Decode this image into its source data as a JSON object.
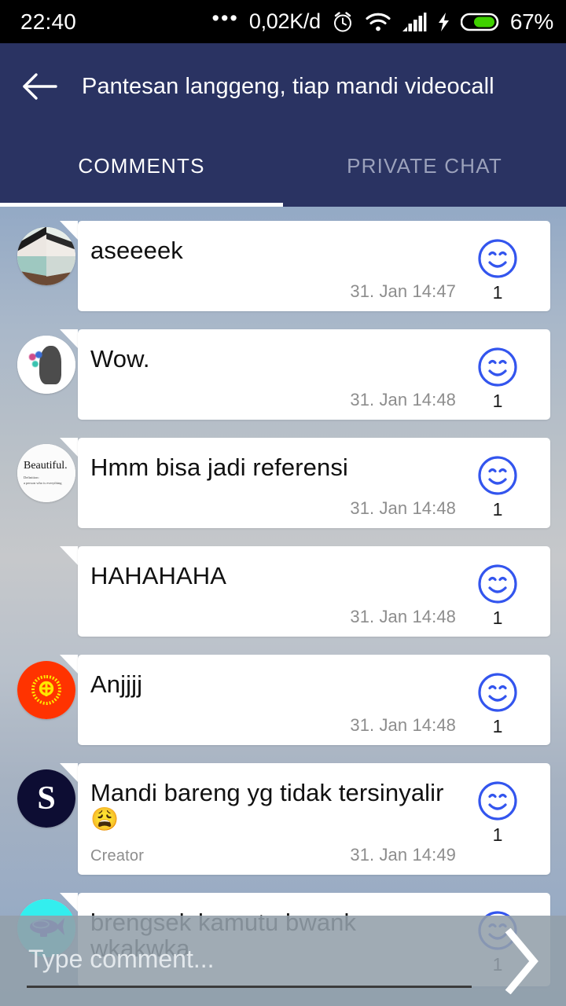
{
  "statusbar": {
    "time": "22:40",
    "dots": "•••",
    "data_rate": "0,02K/d",
    "alarm_icon": "alarm-clock-icon",
    "wifi_icon": "wifi-icon",
    "signal_icon": "signal-bars-icon",
    "charging_icon": "charging-bolt-icon",
    "battery_icon": "battery-icon",
    "battery_percent": "67%",
    "battery_color": "#3fd000",
    "bg_color": "#000000"
  },
  "header": {
    "back_icon": "back-arrow-icon",
    "title": "Pantesan langgeng, tiap mandi videocall",
    "bg_color": "#2a3362",
    "tabs": [
      {
        "label": "COMMENTS",
        "active": true
      },
      {
        "label": "PRIVATE CHAT",
        "active": false
      }
    ]
  },
  "chat": {
    "like_icon": "smiley-face-icon",
    "like_icon_color": "#3355ee",
    "comments": [
      {
        "text": "aseeeek",
        "emoji": "",
        "role": "",
        "likes": "1",
        "time": "31. Jan 14:47",
        "avatar": {
          "type": "collage",
          "name": "avatar-photo-collage",
          "bg": "#e4ebe7",
          "letter": ""
        }
      },
      {
        "text": "Wow.",
        "emoji": "",
        "role": "",
        "likes": "1",
        "time": "31. Jan 14:48",
        "avatar": {
          "type": "art",
          "name": "avatar-statue-art",
          "bg": "#ffffff",
          "letter": ""
        }
      },
      {
        "text": "Hmm bisa jadi referensi",
        "emoji": "",
        "role": "",
        "likes": "1",
        "time": "31. Jan 14:48",
        "avatar": {
          "type": "beautiful",
          "name": "avatar-beautiful-text",
          "bg": "#fbfbfb",
          "letter": "",
          "title": "Beautiful.",
          "subtitle": "Definition:\na person who is everything"
        }
      },
      {
        "text": "HAHAHAHA",
        "emoji": "",
        "role": "",
        "likes": "1",
        "time": "31. Jan 14:48",
        "avatar": {
          "type": "none",
          "name": "avatar-missing",
          "bg": "transparent",
          "letter": ""
        }
      },
      {
        "text": "Anjjjj",
        "emoji": "",
        "role": "",
        "likes": "1",
        "time": "31. Jan 14:48",
        "avatar": {
          "type": "emblem",
          "name": "avatar-orange-emblem",
          "bg": "#ff3300",
          "letter": ""
        }
      },
      {
        "text": "Mandi bareng yg tidak tersinyalir",
        "emoji": "😩",
        "role": "Creator",
        "likes": "1",
        "time": "31. Jan 14:49",
        "avatar": {
          "type": "letter",
          "name": "avatar-letter-s",
          "bg": "#0d0d33",
          "letter": "S"
        }
      },
      {
        "text": "brengsek kamutu bwank wkakwka",
        "emoji": "",
        "role": "",
        "likes": "1",
        "time": "",
        "avatar": {
          "type": "blimp",
          "name": "avatar-blimp",
          "bg": "#33eeee",
          "letter": ""
        }
      }
    ]
  },
  "composer": {
    "placeholder": "Type comment...",
    "value": "",
    "send_icon": "send-chevron-icon"
  }
}
